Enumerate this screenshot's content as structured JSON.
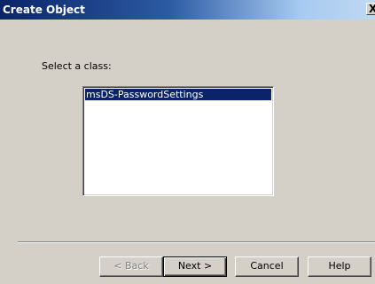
{
  "window": {
    "title": "Create Object",
    "close_glyph": "X"
  },
  "main": {
    "prompt": "Select a class:",
    "class_list": {
      "items": [
        "msDS-PasswordSettings"
      ],
      "selected_index": 0
    }
  },
  "buttons": {
    "back": "< Back",
    "back_enabled": false,
    "next": "Next >",
    "cancel": "Cancel",
    "help": "Help"
  },
  "colors": {
    "title_bar_start": "#0a246a",
    "title_bar_end": "#a6caf0",
    "selection": "#0a246a",
    "dialog_face": "#d4d0c8"
  }
}
